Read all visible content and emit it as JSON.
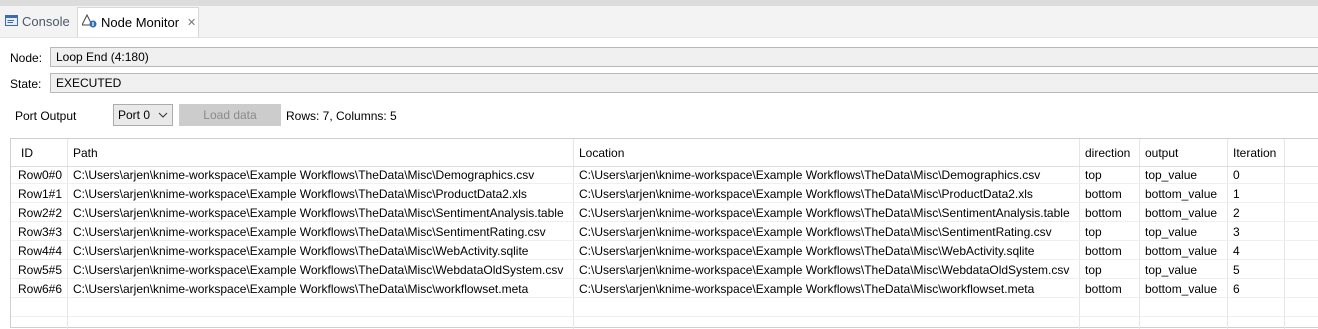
{
  "tabs": {
    "console_label": "Console",
    "node_monitor_label": "Node Monitor"
  },
  "node": {
    "label": "Node:",
    "value": "Loop End  (4:180)"
  },
  "state": {
    "label": "State:",
    "value": "EXECUTED"
  },
  "port": {
    "label": "Port Output",
    "selected": "Port 0",
    "load_button": "Load data",
    "info": "Rows: 7, Columns: 5"
  },
  "table": {
    "headers": [
      "ID",
      "Path",
      "Location",
      "direction",
      "output",
      "Iteration"
    ],
    "rows": [
      [
        "Row0#0",
        "C:\\Users\\arjen\\knime-workspace\\Example Workflows\\TheData\\Misc\\Demographics.csv",
        "C:\\Users\\arjen\\knime-workspace\\Example Workflows\\TheData\\Misc\\Demographics.csv",
        "top",
        "top_value",
        "0"
      ],
      [
        "Row1#1",
        "C:\\Users\\arjen\\knime-workspace\\Example Workflows\\TheData\\Misc\\ProductData2.xls",
        "C:\\Users\\arjen\\knime-workspace\\Example Workflows\\TheData\\Misc\\ProductData2.xls",
        "bottom",
        "bottom_value",
        "1"
      ],
      [
        "Row2#2",
        "C:\\Users\\arjen\\knime-workspace\\Example Workflows\\TheData\\Misc\\SentimentAnalysis.table",
        "C:\\Users\\arjen\\knime-workspace\\Example Workflows\\TheData\\Misc\\SentimentAnalysis.table",
        "bottom",
        "bottom_value",
        "2"
      ],
      [
        "Row3#3",
        "C:\\Users\\arjen\\knime-workspace\\Example Workflows\\TheData\\Misc\\SentimentRating.csv",
        "C:\\Users\\arjen\\knime-workspace\\Example Workflows\\TheData\\Misc\\SentimentRating.csv",
        "top",
        "top_value",
        "3"
      ],
      [
        "Row4#4",
        "C:\\Users\\arjen\\knime-workspace\\Example Workflows\\TheData\\Misc\\WebActivity.sqlite",
        "C:\\Users\\arjen\\knime-workspace\\Example Workflows\\TheData\\Misc\\WebActivity.sqlite",
        "bottom",
        "bottom_value",
        "4"
      ],
      [
        "Row5#5",
        "C:\\Users\\arjen\\knime-workspace\\Example Workflows\\TheData\\Misc\\WebdataOldSystem.csv",
        "C:\\Users\\arjen\\knime-workspace\\Example Workflows\\TheData\\Misc\\WebdataOldSystem.csv",
        "top",
        "top_value",
        "5"
      ],
      [
        "Row6#6",
        "C:\\Users\\arjen\\knime-workspace\\Example Workflows\\TheData\\Misc\\workflowset.meta",
        "C:\\Users\\arjen\\knime-workspace\\Example Workflows\\TheData\\Misc\\workflowset.meta",
        "bottom",
        "bottom_value",
        "6"
      ]
    ]
  },
  "icons": {
    "console": "console-icon",
    "node_monitor": "node-monitor-icon",
    "close": "close-icon",
    "dropdown": "chevron-down-icon"
  }
}
